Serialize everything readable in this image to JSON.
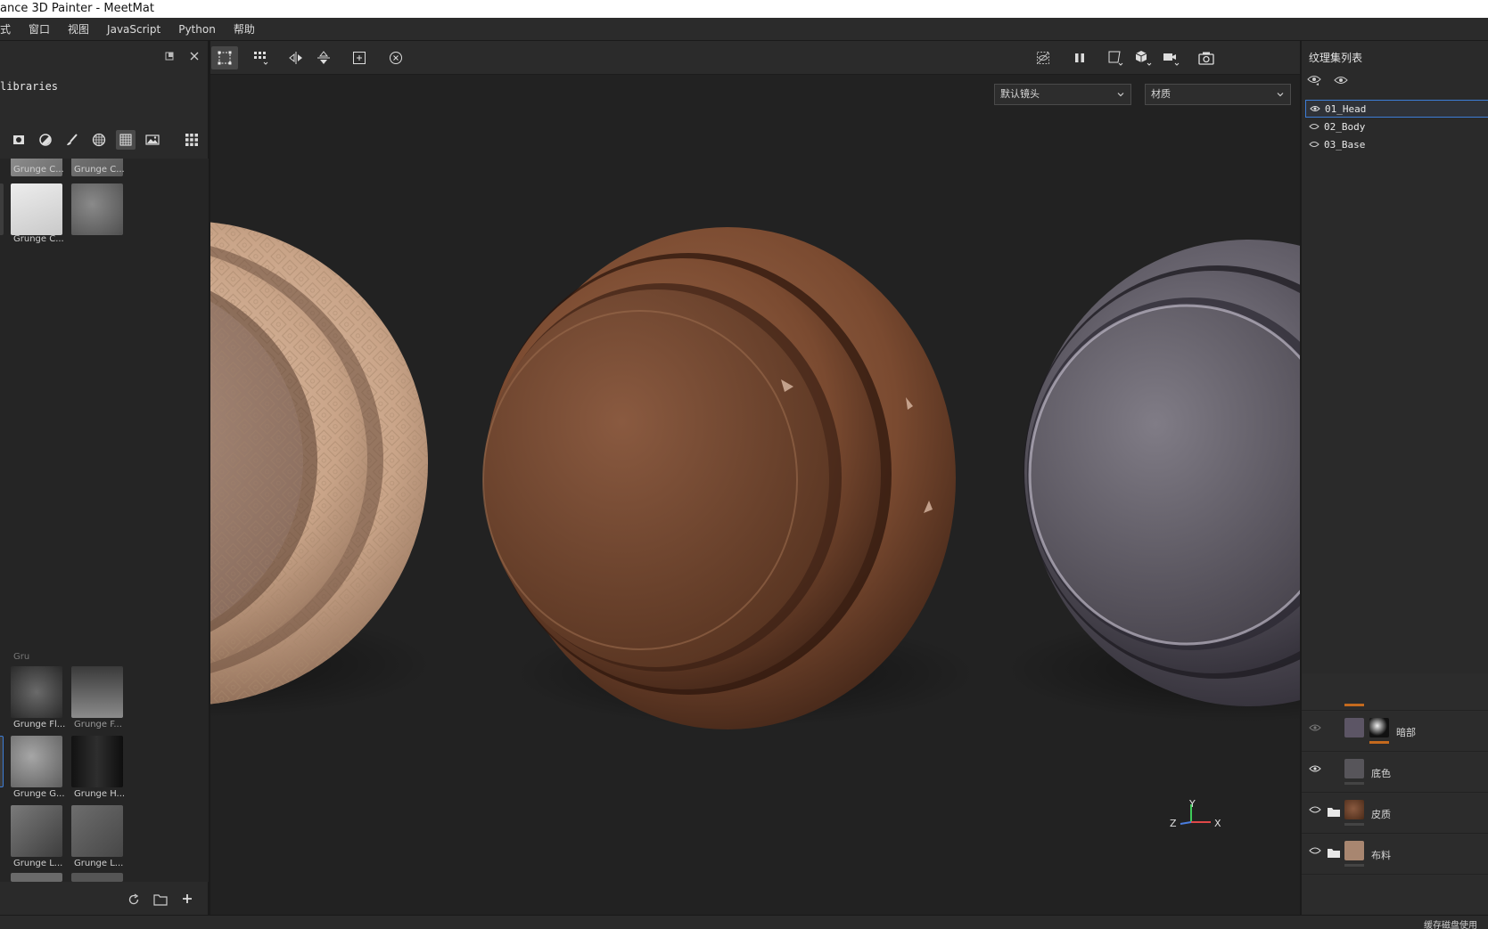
{
  "window": {
    "title": "ance 3D Painter - MeetMat"
  },
  "menu": [
    "模式",
    "窗口",
    "视图",
    "JavaScript",
    "Python",
    "帮助"
  ],
  "menu_visible": [
    "式",
    "窗口",
    "视图",
    "JavaScript",
    "Python",
    "帮助"
  ],
  "shelf": {
    "title": "libraries",
    "items": [
      {
        "label": "Grunge C..."
      },
      {
        "label": "Grunge C..."
      },
      {
        "label": "Grunge C..."
      },
      {
        "label": "Gru"
      },
      {
        "label": "Grunge Fl..."
      },
      {
        "label": "Grunge F..."
      },
      {
        "label": "Grunge G..."
      },
      {
        "label": "Grunge H..."
      },
      {
        "label": "Grunge L..."
      },
      {
        "label": "Grunge L..."
      }
    ]
  },
  "viewport": {
    "camera_select": "默认镜头",
    "mode_select": "材质",
    "axes": {
      "x": "X",
      "y": "Y",
      "z": "Z"
    },
    "spheres": [
      {
        "name": "cloth",
        "color": "#c9a488"
      },
      {
        "name": "leather",
        "color": "#7a4a30"
      },
      {
        "name": "metal",
        "color": "#5a5660"
      }
    ]
  },
  "texture_sets": {
    "title": "纹理集列表",
    "items": [
      {
        "name": "01_Head",
        "selected": true
      },
      {
        "name": "02_Body",
        "selected": false
      },
      {
        "name": "03_Base",
        "selected": false
      }
    ]
  },
  "layers": [
    {
      "name": "暗部",
      "folder": false,
      "thumb": "#5c5565"
    },
    {
      "name": "底色",
      "folder": false,
      "thumb": "#57555a"
    },
    {
      "name": "皮质",
      "folder": true,
      "thumb": "#6b3f2a"
    },
    {
      "name": "布料",
      "folder": true,
      "thumb": "#a88670"
    }
  ],
  "status": {
    "text": "缓存磁盘使用"
  },
  "colors": {
    "accent": "#3d7dd6",
    "orange": "#c46a1e"
  }
}
